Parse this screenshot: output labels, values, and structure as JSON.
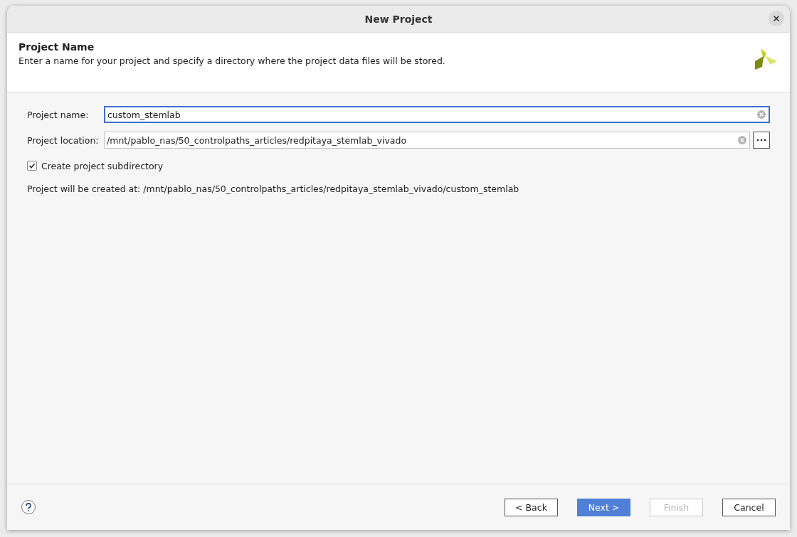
{
  "window": {
    "title": "New Project"
  },
  "header": {
    "title": "Project Name",
    "description": "Enter a name for your project and specify a directory where the project data files will be stored."
  },
  "fields": [
    {
      "label": "Project name:",
      "value": "custom_stemlab",
      "focused": true,
      "browse": false
    },
    {
      "label": "Project location:",
      "value": "/mnt/pablo_nas/50_controlpaths_articles/redpitaya_stemlab_vivado",
      "focused": false,
      "browse": true
    }
  ],
  "subdirectory": {
    "label": "Create project subdirectory",
    "checked": true
  },
  "result_path": "Project will be created at: /mnt/pablo_nas/50_controlpaths_articles/redpitaya_stemlab_vivado/custom_stemlab",
  "buttons": [
    {
      "label": "< Back",
      "kind": "default",
      "disabled": false
    },
    {
      "label": "Next >",
      "kind": "primary",
      "disabled": false
    },
    {
      "label": "Finish",
      "kind": "default",
      "disabled": true
    },
    {
      "label": "Cancel",
      "kind": "default",
      "disabled": false
    }
  ]
}
